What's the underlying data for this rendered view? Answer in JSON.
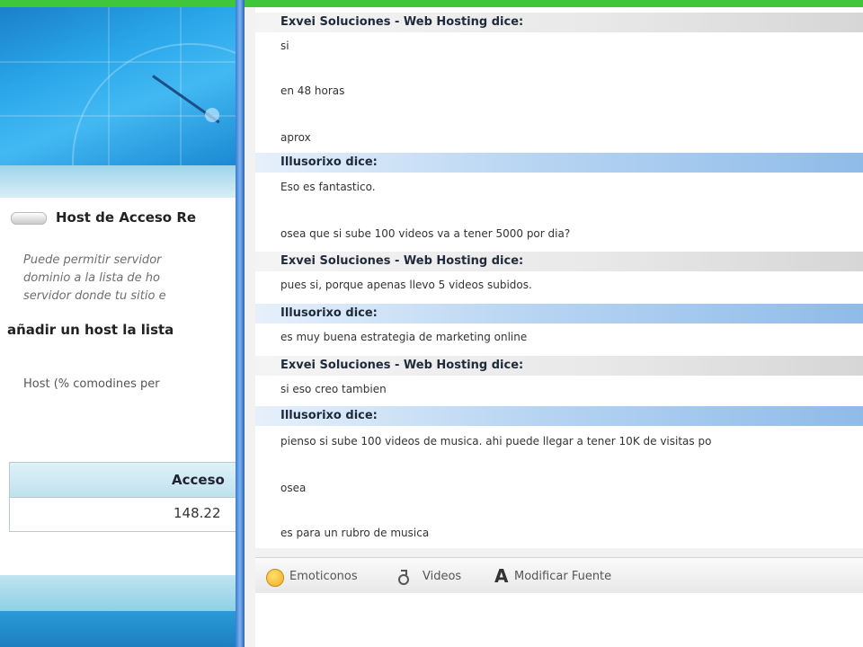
{
  "left_window": {
    "host_title": "Host de Acceso Re",
    "host_description_lines": [
      "Puede permitir servidor",
      "dominio a la lista de ho",
      "servidor donde tu sitio e"
    ],
    "add_host_heading": "añadir un host la lista",
    "host_field_label": "Host (% comodines per",
    "access_table": {
      "header": "Acceso",
      "value": "148.22"
    }
  },
  "chat": {
    "messages": [
      {
        "sender": "Exvei Soluciones - Web Hosting dice:",
        "role": "other",
        "lines": [
          "si",
          "en 48 horas",
          "aprox"
        ]
      },
      {
        "sender": "Illusorixo dice:",
        "role": "me",
        "lines": [
          "Eso es fantastico.",
          "osea que si sube 100 videos va a tener 5000 por dia?"
        ]
      },
      {
        "sender": "Exvei Soluciones - Web Hosting dice:",
        "role": "other",
        "lines": [
          "pues si, porque apenas llevo 5 videos subidos."
        ]
      },
      {
        "sender": "Illusorixo dice:",
        "role": "me",
        "lines": [
          "es muy buena estrategia de marketing online"
        ]
      },
      {
        "sender": "Exvei Soluciones - Web Hosting dice:",
        "role": "other",
        "lines": [
          "si eso creo tambien"
        ]
      },
      {
        "sender": "Illusorixo dice:",
        "role": "me",
        "lines": [
          "pienso si sube 100 videos de musica. ahi puede llegar a tener 10K de visitas po",
          "osea",
          "es para un rubro de musica"
        ]
      }
    ],
    "toolbar": {
      "emoticons_label": "Emoticonos",
      "video_label": "Videos",
      "font_label": "Modificar Fuente"
    }
  },
  "colors": {
    "accent_green": "#3fc63a",
    "sender_me": "#8fbbe9",
    "sender_other": "#d6d6d6",
    "divider_blue": "#3d7bd0"
  }
}
